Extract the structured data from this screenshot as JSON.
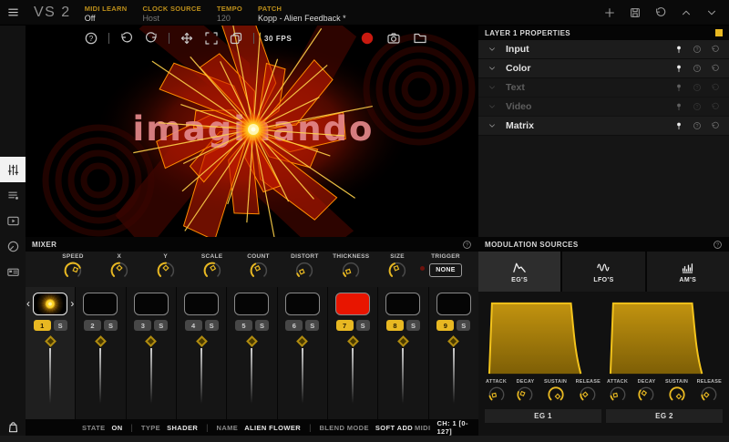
{
  "top_bar": {
    "logo": "VS 2",
    "fields": [
      {
        "label": "MIDI LEARN",
        "value": "Off",
        "dim": false
      },
      {
        "label": "CLOCK SOURCE",
        "value": "Host",
        "dim": true
      },
      {
        "label": "TEMPO",
        "value": "120",
        "dim": true
      },
      {
        "label": "PATCH",
        "value": "Kopp - Alien Feedback *",
        "dim": false
      }
    ],
    "actions": [
      "add-patch-icon",
      "save-icon",
      "revert-icon",
      "chevron-up-icon",
      "chevron-down-icon"
    ]
  },
  "sidebar": {
    "items": [
      "mixer-view-icon",
      "playlist-view-icon",
      "video-view-icon",
      "controls-view-icon",
      "midi-map-view-icon"
    ],
    "selected_index": 0,
    "store_icon": "shopping-bag-icon"
  },
  "viewer": {
    "toolbar_left": [
      "help-icon",
      "divider",
      "undo-icon",
      "redo-icon",
      "divider",
      "pan-icon",
      "fullscreen-icon",
      "layers-icon",
      "divider"
    ],
    "fps": "30 FPS",
    "toolbar_right": [
      "record-icon",
      "camera-icon",
      "folder-icon"
    ],
    "watermark": "imaginando"
  },
  "layer_properties": {
    "title": "LAYER 1 PROPERTIES",
    "accent_chip_color": "#e8b822",
    "sections": [
      {
        "label": "Input",
        "enabled": true
      },
      {
        "label": "Color",
        "enabled": true
      },
      {
        "label": "Text",
        "enabled": false
      },
      {
        "label": "Video",
        "enabled": false
      },
      {
        "label": "Matrix",
        "enabled": true
      }
    ]
  },
  "mixer": {
    "title": "MIXER",
    "knobs": [
      {
        "label": "SPEED",
        "pct": 0.75,
        "indicator": "diamond"
      },
      {
        "label": "X",
        "pct": 0.5,
        "indicator": "diamond"
      },
      {
        "label": "Y",
        "pct": 0.5,
        "indicator": "diamond"
      },
      {
        "label": "SCALE",
        "pct": 0.55,
        "indicator": "diamond"
      },
      {
        "label": "COUNT",
        "pct": 0.4,
        "indicator": "square"
      },
      {
        "label": "DISTORT",
        "pct": 0.08,
        "indicator": "square"
      },
      {
        "label": "THICKNESS",
        "pct": 0.1,
        "indicator": "square"
      },
      {
        "label": "SIZE",
        "pct": 0.42,
        "indicator": "square"
      }
    ],
    "trigger": {
      "label": "TRIGGER",
      "value": "NONE"
    }
  },
  "layers": {
    "prev": "‹",
    "next": "›",
    "strips": [
      {
        "num": "1",
        "solo": "S",
        "thumb": "flower",
        "num_on": true,
        "selected": true
      },
      {
        "num": "2",
        "solo": "S",
        "thumb": "black",
        "num_on": false,
        "selected": false
      },
      {
        "num": "3",
        "solo": "S",
        "thumb": "black",
        "num_on": false,
        "selected": false
      },
      {
        "num": "4",
        "solo": "S",
        "thumb": "black",
        "num_on": false,
        "selected": false
      },
      {
        "num": "5",
        "solo": "S",
        "thumb": "black",
        "num_on": false,
        "selected": false
      },
      {
        "num": "6",
        "solo": "S",
        "thumb": "black",
        "num_on": false,
        "selected": false
      },
      {
        "num": "7",
        "solo": "S",
        "thumb": "red",
        "num_on": true,
        "selected": false
      },
      {
        "num": "8",
        "solo": "S",
        "thumb": "black",
        "num_on": true,
        "selected": false
      },
      {
        "num": "9",
        "solo": "S",
        "thumb": "black",
        "num_on": true,
        "selected": false
      }
    ]
  },
  "modulation": {
    "title": "MODULATION SOURCES",
    "tabs": [
      {
        "label": "EG'S",
        "icon": "envelope-icon",
        "selected": true
      },
      {
        "label": "LFO'S",
        "icon": "sine-wave-icon",
        "selected": false
      },
      {
        "label": "AM'S",
        "icon": "audio-bars-icon",
        "selected": false
      }
    ],
    "egs": [
      {
        "name": "EG 1",
        "knobs": [
          {
            "label": "ATTACK",
            "pct": 0.12,
            "indicator": "square"
          },
          {
            "label": "DECAY",
            "pct": 0.25,
            "indicator": "square"
          },
          {
            "label": "SUSTAIN",
            "pct": 1,
            "indicator": "square"
          },
          {
            "label": "RELEASE",
            "pct": 0.18,
            "indicator": "diamond"
          }
        ]
      },
      {
        "name": "EG 2",
        "knobs": [
          {
            "label": "ATTACK",
            "pct": 0.12,
            "indicator": "square"
          },
          {
            "label": "DECAY",
            "pct": 0.3,
            "indicator": "square"
          },
          {
            "label": "SUSTAIN",
            "pct": 1,
            "indicator": "square"
          },
          {
            "label": "RELEASE",
            "pct": 0.15,
            "indicator": "diamond"
          }
        ]
      }
    ]
  },
  "status_bar": {
    "fields": [
      {
        "label": "STATE",
        "value": "ON"
      },
      {
        "label": "TYPE",
        "value": "SHADER"
      },
      {
        "label": "NAME",
        "value": "ALIEN FLOWER"
      },
      {
        "label": "BLEND MODE",
        "value": "SOFT ADD"
      }
    ],
    "midi_label": "MIDI",
    "midi_value": "CH: 1 [0-127]"
  },
  "colors": {
    "accent": "#e8b822",
    "record": "#c81a10",
    "layer7_thumb": "#e81500",
    "viz_red": "#d42000",
    "viz_rays": "#ffd24a",
    "watermark_pink": "#e4888a"
  }
}
